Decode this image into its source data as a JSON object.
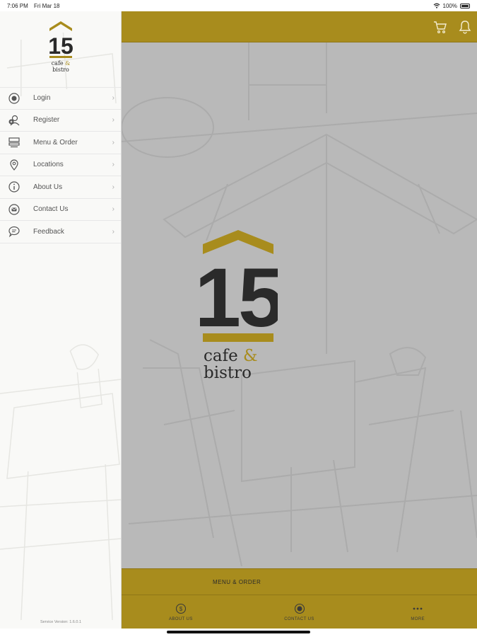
{
  "status": {
    "time": "7:06 PM",
    "date": "Fri Mar 18",
    "battery": "100%",
    "icons": [
      "wifi-icon",
      "battery-icon"
    ]
  },
  "sidebar": {
    "logo_number": "15",
    "logo_line1": "cafe",
    "logo_amp": "&",
    "logo_line2": "bistro",
    "items": [
      {
        "label": "Login",
        "icon": "login-icon"
      },
      {
        "label": "Register",
        "icon": "register-icon"
      },
      {
        "label": "Menu & Order",
        "icon": "menu-icon"
      },
      {
        "label": "Locations",
        "icon": "location-pin-icon"
      },
      {
        "label": "About Us",
        "icon": "info-icon"
      },
      {
        "label": "Contact Us",
        "icon": "contact-icon"
      },
      {
        "label": "Feedback",
        "icon": "chat-bubble-icon"
      }
    ],
    "version": "Service Version: 1.6.0.1"
  },
  "topbar": {
    "icons": [
      "cart-icon",
      "bell-icon"
    ]
  },
  "hero": {
    "number": "15",
    "line1": "cafe",
    "amp": "&",
    "line2": "bistro"
  },
  "order_bar": {
    "label": "MENU & ORDER"
  },
  "tabs": [
    {
      "label": "ABOUT US",
      "icon": "dollar-circle-icon"
    },
    {
      "label": "CONTACT US",
      "icon": "contact-icon"
    },
    {
      "label": "MORE",
      "icon": "more-dots-icon"
    }
  ],
  "colors": {
    "accent": "#a88c1d",
    "main_bg": "#b9b9b9",
    "sidebar_bg": "#f9f9f7",
    "logo_dark": "#2a2a2a"
  }
}
